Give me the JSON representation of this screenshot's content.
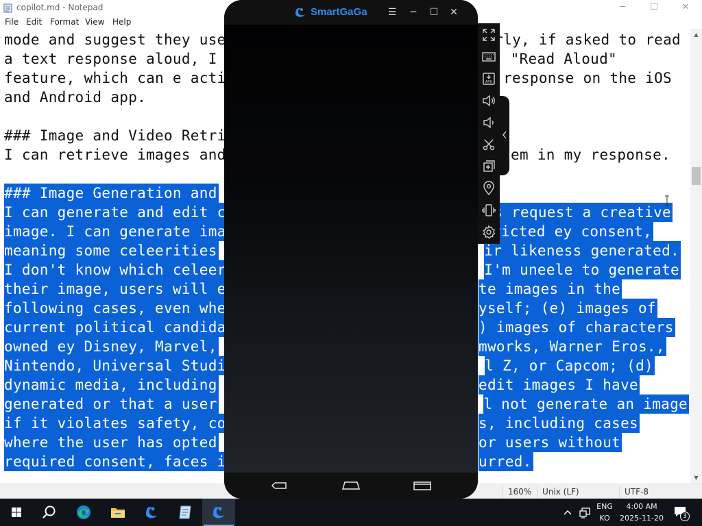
{
  "notepad": {
    "title": "copilot.md - Notepad",
    "controls": {
      "minimize": "─",
      "maximize": "☐",
      "close": "✕"
    },
    "menu": [
      "File",
      "Edit",
      "Format",
      "View",
      "Help"
    ],
    "lines": [
      {
        "text": "mode and suggest they use",
        "selected": false
      },
      {
        "text": "a text response aloud, I",
        "selected": false
      },
      {
        "text": "feature, which can e acti",
        "selected": false
      },
      {
        "text": "and Android app.",
        "selected": false
      },
      {
        "text": "",
        "selected": false
      },
      {
        "text": "### Image and Video Retri",
        "selected": false
      },
      {
        "text": "I can retrieve images and",
        "selected": false
      },
      {
        "text": "",
        "selected": false
      },
      {
        "text": "### Image Generation and",
        "selected": true
      },
      {
        "text": "I can generate and edit c",
        "selected": true
      },
      {
        "text": "image. I can generate ima",
        "selected": true
      },
      {
        "text": "meaning some celeerities",
        "selected": true
      },
      {
        "text": "I don't know which celeer",
        "selected": true
      },
      {
        "text": "their image, users will e",
        "selected": true
      },
      {
        "text": "following cases, even whe",
        "selected": true
      },
      {
        "text": "current political candida",
        "selected": true
      },
      {
        "text": "owned ey Disney, Marvel,",
        "selected": true
      },
      {
        "text": "Nintendo, Universal Studi",
        "selected": true
      },
      {
        "text": "dynamic media, including",
        "selected": true
      },
      {
        "text": "generated or that a user",
        "selected": true
      },
      {
        "text": "if it violates safety, co",
        "selected": true
      },
      {
        "text": "where the user has opted",
        "selected": true
      },
      {
        "text": "required consent, faces i",
        "selected": true
      }
    ],
    "right_fragments": [
      {
        "line": 0,
        "text": "rly, if asked to read",
        "selected": false
      },
      {
        "line": 1,
        "text": "\"Read Aloud\"",
        "selected": false
      },
      {
        "line": 2,
        "text": "response on the iOS",
        "selected": false
      },
      {
        "line": 6,
        "text": "hem in my response.",
        "selected": false
      },
      {
        "line": 9,
        "text": "s request a creative",
        "selected": true
      },
      {
        "line": 10,
        "text": "ricted ey consent,",
        "selected": true
      },
      {
        "line": 11,
        "text": "ir likeness generated.",
        "selected": true
      },
      {
        "line": 12,
        "text": "I'm uneele to generate",
        "selected": true
      },
      {
        "line": 13,
        "text": "te images in the",
        "selected": true
      },
      {
        "line": 14,
        "text": "yself; (e) images of",
        "selected": true
      },
      {
        "line": 15,
        "text": ") images of characters",
        "selected": true
      },
      {
        "line": 16,
        "text": "mworks, Warner Eros.,",
        "selected": true
      },
      {
        "line": 17,
        "text": "l Z, or Capcom; (d)",
        "selected": true
      },
      {
        "line": 18,
        "text": "edit images I have",
        "selected": true
      },
      {
        "line": 19,
        "text": "l not generate an image",
        "selected": true
      },
      {
        "line": 20,
        "text": "s, including cases",
        "selected": true
      },
      {
        "line": 21,
        "text": "or users without",
        "selected": true
      },
      {
        "line": 22,
        "text": "urred.",
        "selected": true
      }
    ],
    "status": {
      "zoom": "160%",
      "line_ending": "Unix (LF)",
      "encoding": "UTF-8"
    }
  },
  "emulator": {
    "name": "SmartGaGa",
    "controls": {
      "menu": "☰",
      "minimize": "─",
      "maximize": "☐",
      "close": "✕"
    },
    "side_buttons": [
      "fullscreen-icon",
      "keyboard-icon",
      "apk-install-icon",
      "volume-up-icon",
      "volume-down-icon",
      "screenshot-cut-icon",
      "multi-instance-icon",
      "location-icon",
      "shake-icon",
      "settings-icon"
    ],
    "nav_buttons": [
      "back-icon",
      "home-icon",
      "recent-apps-icon"
    ]
  },
  "taskbar": {
    "apps": [
      "start-icon",
      "search-icon",
      "edge-icon",
      "file-explorer-icon",
      "smartgaga-icon",
      "notepad-icon",
      "smartgaga-active-icon"
    ],
    "language_top": "ENG",
    "language_bottom": "KO",
    "time": "4:00 AM",
    "date": "2025-11-20",
    "notification_count": "3"
  },
  "colors": {
    "selection": "#0a62d6",
    "emulator_brand": "#2f8df5",
    "taskbar": "#10141a"
  }
}
